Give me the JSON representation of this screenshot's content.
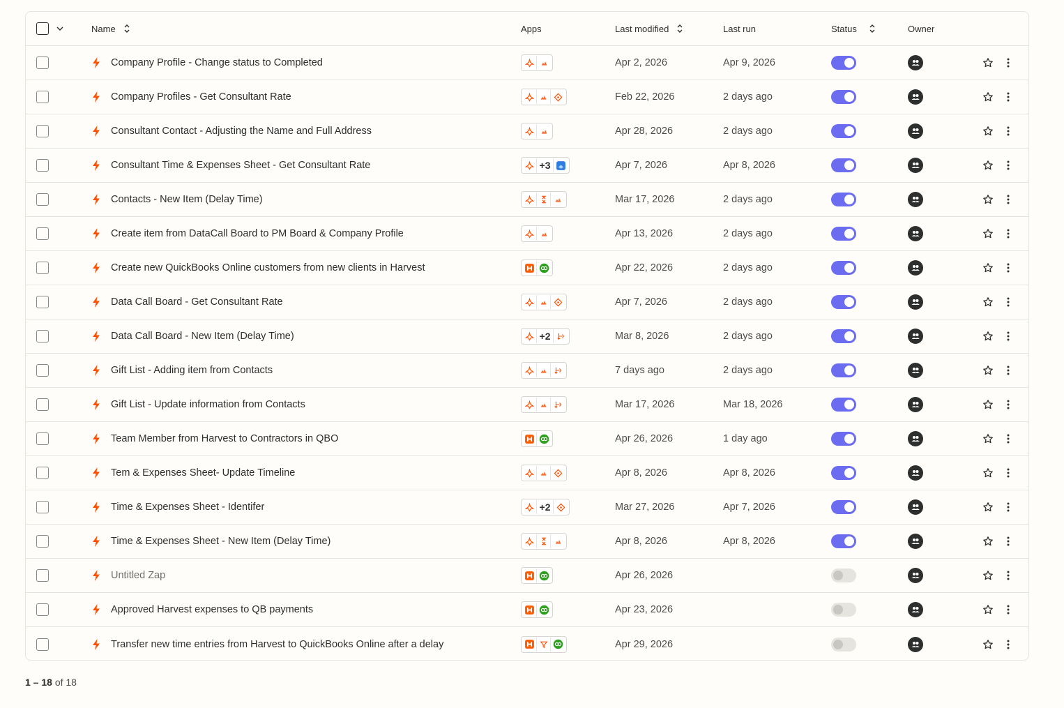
{
  "header": {
    "name": "Name",
    "apps": "Apps",
    "last_modified": "Last modified",
    "last_run": "Last run",
    "status": "Status",
    "owner": "Owner"
  },
  "colors": {
    "accent": "#ff4f00",
    "toggle_on": "#6b6cf0",
    "toggle_off": "#e6e4df"
  },
  "rows": [
    {
      "name": "Company Profile - Change status to Completed",
      "apps": [
        "monday",
        "triangle"
      ],
      "more": "",
      "modified": "Apr 2, 2026",
      "run": "Apr 9, 2026",
      "status": "on"
    },
    {
      "name": "Company Profiles - Get Consultant Rate",
      "apps": [
        "monday",
        "triangle",
        "sparkle"
      ],
      "more": "",
      "modified": "Feb 22, 2026",
      "run": "2 days ago",
      "status": "on"
    },
    {
      "name": "Consultant Contact - Adjusting the Name and Full Address",
      "apps": [
        "monday",
        "triangle"
      ],
      "more": "",
      "modified": "Apr 28, 2026",
      "run": "2 days ago",
      "status": "on"
    },
    {
      "name": "Consultant Time & Expenses Sheet - Get Consultant Rate",
      "apps": [
        "monday",
        "more",
        "cube"
      ],
      "more": "+3",
      "modified": "Apr 7, 2026",
      "run": "Apr 8, 2026",
      "status": "on"
    },
    {
      "name": "Contacts - New Item (Delay Time)",
      "apps": [
        "monday",
        "hourglass",
        "triangle"
      ],
      "more": "",
      "modified": "Mar 17, 2026",
      "run": "2 days ago",
      "status": "on"
    },
    {
      "name": "Create item from DataCall Board to PM Board & Company Profile",
      "apps": [
        "monday",
        "triangle"
      ],
      "more": "",
      "modified": "Apr 13, 2026",
      "run": "2 days ago",
      "status": "on"
    },
    {
      "name": "Create new QuickBooks Online customers from new clients in Harvest",
      "apps": [
        "harvest",
        "qb"
      ],
      "more": "",
      "modified": "Apr 22, 2026",
      "run": "2 days ago",
      "status": "on"
    },
    {
      "name": "Data Call Board - Get Consultant Rate",
      "apps": [
        "monday",
        "triangle",
        "sparkle"
      ],
      "more": "",
      "modified": "Apr 7, 2026",
      "run": "2 days ago",
      "status": "on"
    },
    {
      "name": "Data Call Board - New Item (Delay Time)",
      "apps": [
        "monday",
        "more",
        "paths"
      ],
      "more": "+2",
      "modified": "Mar 8, 2026",
      "run": "2 days ago",
      "status": "on"
    },
    {
      "name": "Gift List - Adding item from Contacts",
      "apps": [
        "monday",
        "triangle",
        "paths"
      ],
      "more": "",
      "modified": "7 days ago",
      "run": "2 days ago",
      "status": "on"
    },
    {
      "name": "Gift List - Update information from Contacts",
      "apps": [
        "monday",
        "triangle",
        "paths"
      ],
      "more": "",
      "modified": "Mar 17, 2026",
      "run": "Mar 18, 2026",
      "status": "on"
    },
    {
      "name": "Team Member from Harvest to Contractors in QBO",
      "apps": [
        "harvest",
        "qb"
      ],
      "more": "",
      "modified": "Apr 26, 2026",
      "run": "1 day ago",
      "status": "on"
    },
    {
      "name": "Tem & Expenses Sheet- Update Timeline",
      "apps": [
        "monday",
        "triangle",
        "sparkle"
      ],
      "more": "",
      "modified": "Apr 8, 2026",
      "run": "Apr 8, 2026",
      "status": "on"
    },
    {
      "name": "Time & Expenses Sheet - Identifer",
      "apps": [
        "monday",
        "more",
        "sparkle"
      ],
      "more": "+2",
      "modified": "Mar 27, 2026",
      "run": "Apr 7, 2026",
      "status": "on"
    },
    {
      "name": "Time & Expenses Sheet - New Item (Delay Time)",
      "apps": [
        "monday",
        "hourglass",
        "triangle"
      ],
      "more": "",
      "modified": "Apr 8, 2026",
      "run": "Apr 8, 2026",
      "status": "on"
    },
    {
      "name": "Untitled Zap",
      "apps": [
        "harvest",
        "qb"
      ],
      "more": "",
      "modified": "Apr 26, 2026",
      "run": "",
      "status": "off",
      "muted": true
    },
    {
      "name": "Approved Harvest expenses to QB payments",
      "apps": [
        "harvest",
        "qb"
      ],
      "more": "",
      "modified": "Apr 23, 2026",
      "run": "",
      "status": "off"
    },
    {
      "name": "Transfer new time entries from Harvest to QuickBooks Online after a delay",
      "apps": [
        "harvest",
        "filter",
        "qb"
      ],
      "more": "",
      "modified": "Apr 29, 2026",
      "run": "",
      "status": "off"
    }
  ],
  "pagination": {
    "range": "1 – 18",
    "of_text": " of 18"
  }
}
